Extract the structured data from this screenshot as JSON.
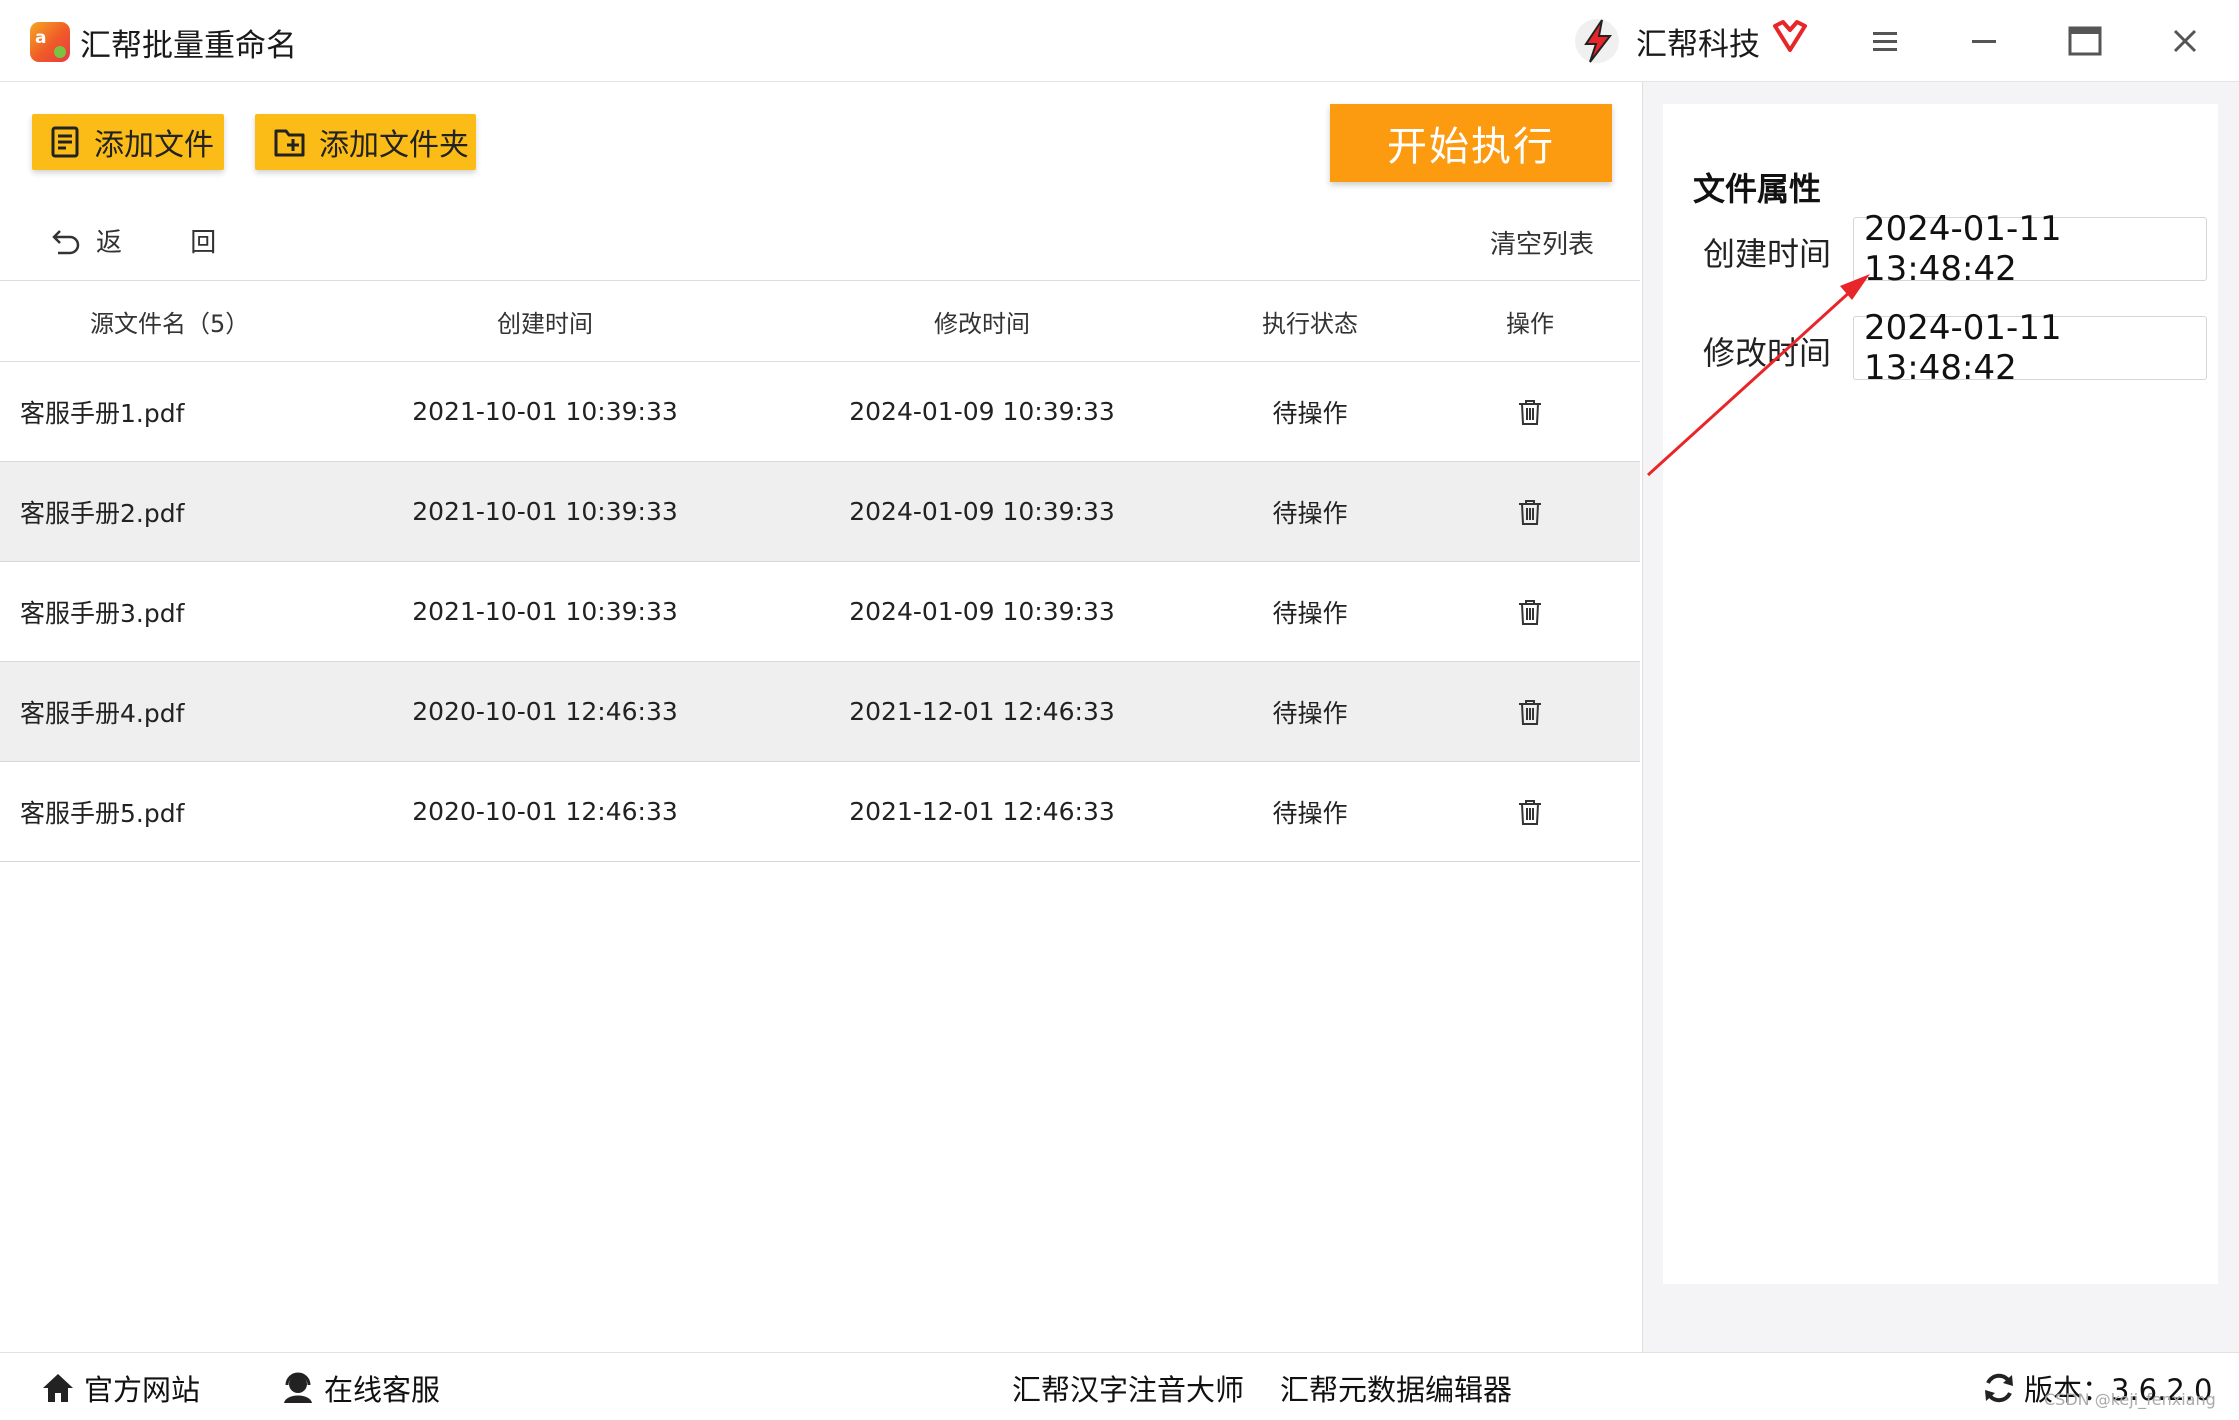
{
  "app": {
    "title": "汇帮批量重命名",
    "brand": "汇帮科技",
    "logo_text": "a"
  },
  "toolbar": {
    "add_file": "添加文件",
    "add_folder": "添加文件夹",
    "run": "开始执行",
    "back": "返 回",
    "clear": "清空列表"
  },
  "table": {
    "headers": {
      "name": "源文件名（5）",
      "ctime": "创建时间",
      "mtime": "修改时间",
      "status": "执行状态",
      "op": "操作"
    },
    "rows": [
      {
        "name": "客服手册1.pdf",
        "ctime": "2021-10-01 10:39:33",
        "mtime": "2024-01-09 10:39:33",
        "status": "待操作"
      },
      {
        "name": "客服手册2.pdf",
        "ctime": "2021-10-01 10:39:33",
        "mtime": "2024-01-09 10:39:33",
        "status": "待操作"
      },
      {
        "name": "客服手册3.pdf",
        "ctime": "2021-10-01 10:39:33",
        "mtime": "2024-01-09 10:39:33",
        "status": "待操作"
      },
      {
        "name": "客服手册4.pdf",
        "ctime": "2020-10-01 12:46:33",
        "mtime": "2021-12-01 12:46:33",
        "status": "待操作"
      },
      {
        "name": "客服手册5.pdf",
        "ctime": "2020-10-01 12:46:33",
        "mtime": "2021-12-01 12:46:33",
        "status": "待操作"
      }
    ]
  },
  "properties": {
    "title": "文件属性",
    "ctime_label": "创建时间",
    "ctime_value": "2024-01-11 13:48:42",
    "mtime_label": "修改时间",
    "mtime_value": "2024-01-11 13:48:42"
  },
  "footer": {
    "website": "官方网站",
    "support": "在线客服",
    "link1": "汇帮汉字注音大师",
    "link2": "汇帮元数据编辑器",
    "version": "版本：3.6.2.0"
  },
  "watermark": "CSDN @keji_fenxiang",
  "colors": {
    "accent_yellow": "#fcbc18",
    "run_orange": "#fc9a10",
    "arrow_red": "#e8262a"
  },
  "icons": [
    "app-logo",
    "brand-logo",
    "vip-icon",
    "menu-icon",
    "minimize-icon",
    "maximize-icon",
    "close-icon",
    "add-file-icon",
    "add-folder-icon",
    "back-icon",
    "trash-icon",
    "home-icon",
    "support-icon",
    "refresh-icon"
  ]
}
